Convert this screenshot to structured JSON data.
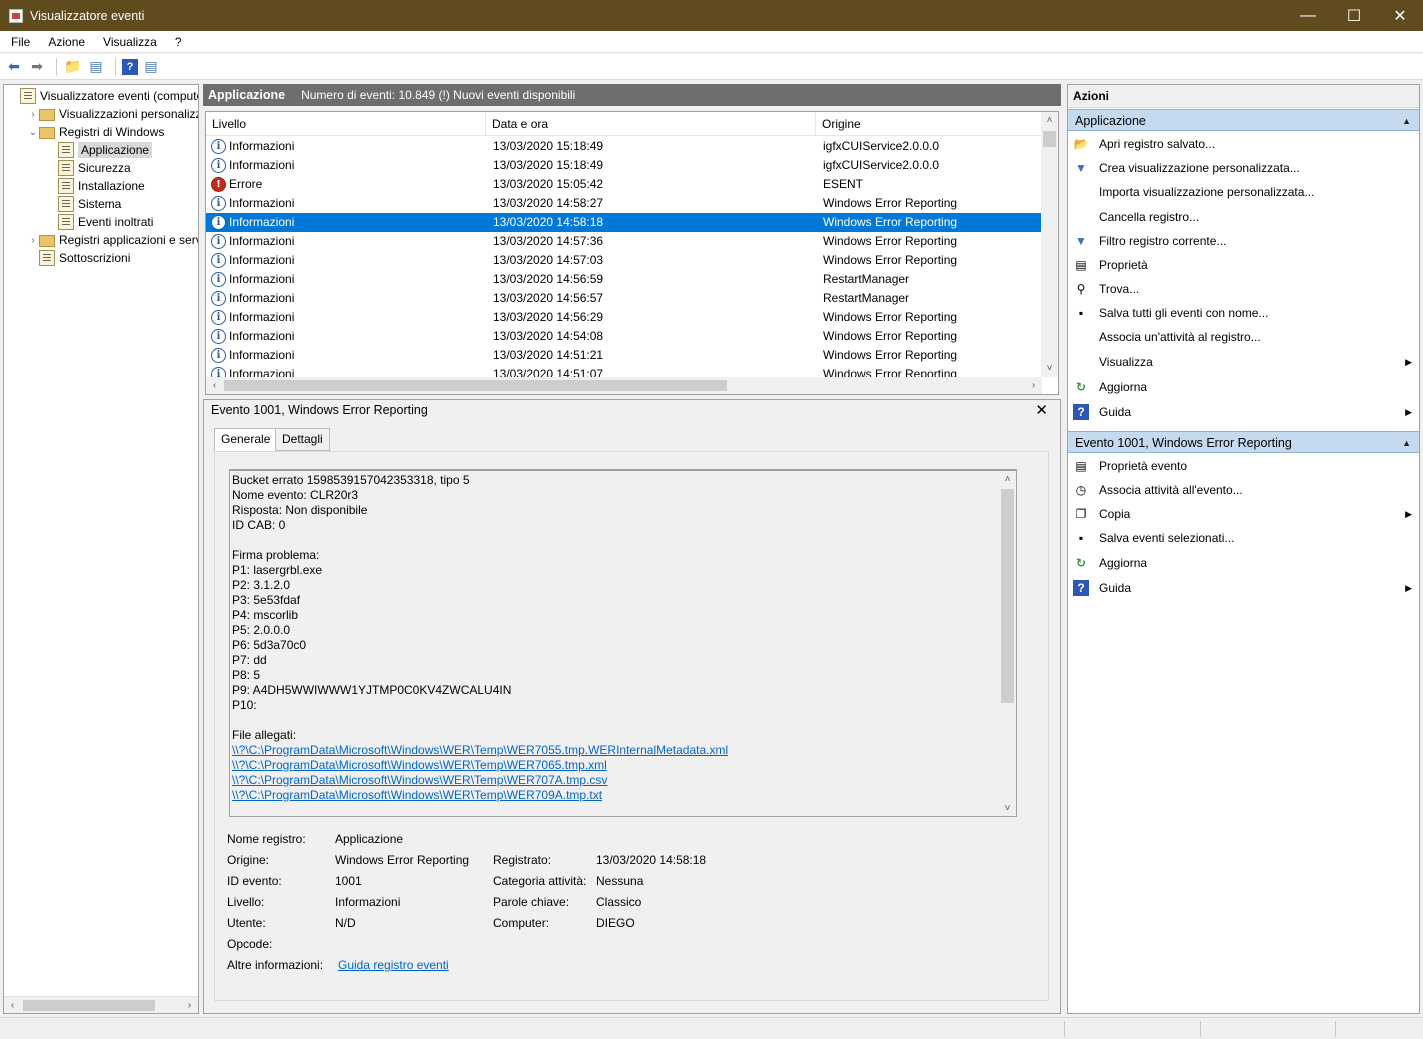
{
  "window": {
    "title": "Visualizzatore eventi"
  },
  "menu": [
    "File",
    "Azione",
    "Visualizza",
    "?"
  ],
  "tree": [
    {
      "label": "Visualizzatore eventi (computer",
      "indent": 0,
      "expander": "",
      "icon": "log"
    },
    {
      "label": "Visualizzazioni personalizzate",
      "indent": 1,
      "expander": "›",
      "icon": "folder"
    },
    {
      "label": "Registri di Windows",
      "indent": 1,
      "expander": "⌄",
      "icon": "folder"
    },
    {
      "label": "Applicazione",
      "indent": 2,
      "expander": "",
      "icon": "log",
      "selected": true
    },
    {
      "label": "Sicurezza",
      "indent": 2,
      "expander": "",
      "icon": "log"
    },
    {
      "label": "Installazione",
      "indent": 2,
      "expander": "",
      "icon": "log"
    },
    {
      "label": "Sistema",
      "indent": 2,
      "expander": "",
      "icon": "log"
    },
    {
      "label": "Eventi inoltrati",
      "indent": 2,
      "expander": "",
      "icon": "log"
    },
    {
      "label": "Registri applicazioni e servizi",
      "indent": 1,
      "expander": "›",
      "icon": "folder"
    },
    {
      "label": "Sottoscrizioni",
      "indent": 1,
      "expander": "",
      "icon": "log"
    }
  ],
  "center": {
    "title": "Applicazione",
    "count": "Numero di eventi: 10.849 (!) Nuovi eventi disponibili"
  },
  "columns": [
    "Livello",
    "Data e ora",
    "Origine"
  ],
  "events": [
    {
      "level": "Informazioni",
      "kind": "info",
      "date": "13/03/2020 15:18:49",
      "source": "igfxCUIService2.0.0.0"
    },
    {
      "level": "Informazioni",
      "kind": "info",
      "date": "13/03/2020 15:18:49",
      "source": "igfxCUIService2.0.0.0"
    },
    {
      "level": "Errore",
      "kind": "error",
      "date": "13/03/2020 15:05:42",
      "source": "ESENT"
    },
    {
      "level": "Informazioni",
      "kind": "info",
      "date": "13/03/2020 14:58:27",
      "source": "Windows Error Reporting"
    },
    {
      "level": "Informazioni",
      "kind": "info",
      "date": "13/03/2020 14:58:18",
      "source": "Windows Error Reporting",
      "selected": true
    },
    {
      "level": "Informazioni",
      "kind": "info",
      "date": "13/03/2020 14:57:36",
      "source": "Windows Error Reporting"
    },
    {
      "level": "Informazioni",
      "kind": "info",
      "date": "13/03/2020 14:57:03",
      "source": "Windows Error Reporting"
    },
    {
      "level": "Informazioni",
      "kind": "info",
      "date": "13/03/2020 14:56:59",
      "source": "RestartManager"
    },
    {
      "level": "Informazioni",
      "kind": "info",
      "date": "13/03/2020 14:56:57",
      "source": "RestartManager"
    },
    {
      "level": "Informazioni",
      "kind": "info",
      "date": "13/03/2020 14:56:29",
      "source": "Windows Error Reporting"
    },
    {
      "level": "Informazioni",
      "kind": "info",
      "date": "13/03/2020 14:54:08",
      "source": "Windows Error Reporting"
    },
    {
      "level": "Informazioni",
      "kind": "info",
      "date": "13/03/2020 14:51:21",
      "source": "Windows Error Reporting"
    },
    {
      "level": "Informazioni",
      "kind": "info",
      "date": "13/03/2020 14:51:07",
      "source": "Windows Error Reporting"
    }
  ],
  "detail": {
    "title": "Evento 1001, Windows Error Reporting",
    "tabs": [
      "Generale",
      "Dettagli"
    ],
    "description": [
      {
        "text": "Bucket errato 1598539157042353318, tipo 5"
      },
      {
        "text": "Nome evento: CLR20r3"
      },
      {
        "text": "Risposta: Non disponibile"
      },
      {
        "text": "ID CAB: 0"
      },
      {
        "text": ""
      },
      {
        "text": "Firma problema:"
      },
      {
        "text": "P1: lasergrbl.exe"
      },
      {
        "text": "P2: 3.1.2.0"
      },
      {
        "text": "P3: 5e53fdaf"
      },
      {
        "text": "P4: mscorlib"
      },
      {
        "text": "P5: 2.0.0.0"
      },
      {
        "text": "P6: 5d3a70c0"
      },
      {
        "text": "P7: dd"
      },
      {
        "text": "P8: 5"
      },
      {
        "text": "P9: A4DH5WWIWWW1YJTMP0C0KV4ZWCALU4IN"
      },
      {
        "text": "P10:"
      },
      {
        "text": ""
      },
      {
        "text": "File allegati:"
      },
      {
        "text": "\\\\?\\C:\\ProgramData\\Microsoft\\Windows\\WER\\Temp\\WER7055.tmp.WERInternalMetadata.xml",
        "link": true
      },
      {
        "text": "\\\\?\\C:\\ProgramData\\Microsoft\\Windows\\WER\\Temp\\WER7065.tmp.xml",
        "link": true
      },
      {
        "text": "\\\\?\\C:\\ProgramData\\Microsoft\\Windows\\WER\\Temp\\WER707A.tmp.csv",
        "link": true
      },
      {
        "text": "\\\\?\\C:\\ProgramData\\Microsoft\\Windows\\WER\\Temp\\WER709A.tmp.txt",
        "link": true
      }
    ],
    "fields": {
      "log_name_label": "Nome registro:",
      "log_name": "Applicazione",
      "source_label": "Origine:",
      "source": "Windows Error Reporting",
      "logged_label": "Registrato:",
      "logged": "13/03/2020 14:58:18",
      "event_id_label": "ID evento:",
      "event_id": "1001",
      "category_label": "Categoria attività:",
      "category": "Nessuna",
      "level_label": "Livello:",
      "level": "Informazioni",
      "keywords_label": "Parole chiave:",
      "keywords": "Classico",
      "user_label": "Utente:",
      "user": "N/D",
      "computer_label": "Computer:",
      "computer": "DIEGO",
      "opcode_label": "Opcode:",
      "more_info_label": "Altre informazioni:",
      "more_info_link": "Guida registro eventi"
    }
  },
  "actions": {
    "title": "Azioni",
    "section1": "Applicazione",
    "items1": [
      {
        "label": "Apri registro salvato...",
        "icon": "open-folder-icon",
        "glyph": "📂"
      },
      {
        "label": "Crea visualizzazione personalizzata...",
        "icon": "filter-create-icon",
        "glyph": "▼"
      },
      {
        "label": "Importa visualizzazione personalizzata...",
        "icon": "",
        "glyph": ""
      },
      {
        "label": "Cancella registro...",
        "icon": "",
        "glyph": ""
      },
      {
        "label": "Filtro registro corrente...",
        "icon": "filter-icon",
        "glyph": "▼"
      },
      {
        "label": "Proprietà",
        "icon": "properties-icon",
        "glyph": "▤"
      },
      {
        "label": "Trova...",
        "icon": "binoculars-icon",
        "glyph": "⚲"
      },
      {
        "label": "Salva tutti gli eventi con nome...",
        "icon": "save-icon",
        "glyph": "▪"
      },
      {
        "label": "Associa un'attività al registro...",
        "icon": "",
        "glyph": ""
      },
      {
        "label": "Visualizza",
        "icon": "",
        "glyph": "",
        "submenu": true
      },
      {
        "label": "Aggiorna",
        "icon": "refresh-icon",
        "glyph": "↻"
      },
      {
        "label": "Guida",
        "icon": "help-icon",
        "glyph": "?",
        "submenu": true
      }
    ],
    "section2": "Evento 1001, Windows Error Reporting",
    "items2": [
      {
        "label": "Proprietà evento",
        "icon": "event-properties-icon",
        "glyph": "▤"
      },
      {
        "label": "Associa attività all'evento...",
        "icon": "task-icon",
        "glyph": "◷"
      },
      {
        "label": "Copia",
        "icon": "copy-icon",
        "glyph": "❐",
        "submenu": true
      },
      {
        "label": "Salva eventi selezionati...",
        "icon": "save-icon",
        "glyph": "▪"
      },
      {
        "label": "Aggiorna",
        "icon": "refresh-icon",
        "glyph": "↻"
      },
      {
        "label": "Guida",
        "icon": "help-icon",
        "glyph": "?",
        "submenu": true
      }
    ]
  }
}
